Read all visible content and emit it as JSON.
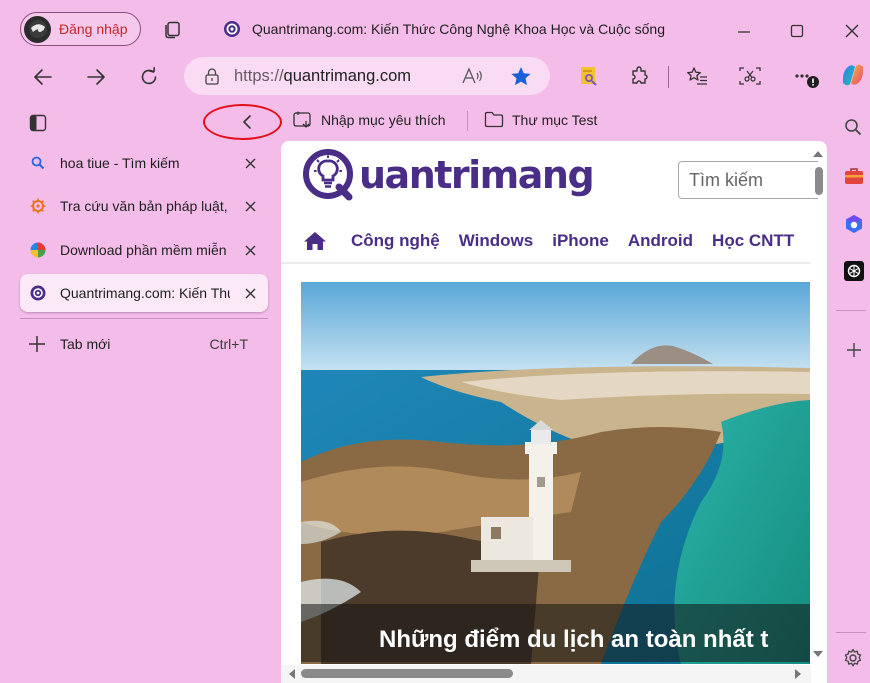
{
  "profile": {
    "label": "Đăng nhập"
  },
  "window": {
    "title": "Quantrimang.com: Kiến Thức Công Nghệ Khoa Học và Cuộc sống"
  },
  "address_bar": {
    "url_protocol": "https://",
    "url_host": "quantrimang.com"
  },
  "favorites": [
    {
      "label": "Nhập mục yêu thích"
    },
    {
      "label": "Thư mục Test"
    }
  ],
  "tabs": [
    {
      "label": "hoa tiue - Tìm kiếm",
      "icon": "search-icon",
      "active": false
    },
    {
      "label": "Tra cứu văn bản pháp luật, ",
      "icon": "wheel-icon",
      "active": false
    },
    {
      "label": "Download phần mềm miễn",
      "icon": "pinwheel-icon",
      "active": false
    },
    {
      "label": "Quantrimang.com: Kiến Thứ",
      "icon": "at-icon",
      "active": true
    }
  ],
  "new_tab": {
    "label": "Tab mới",
    "shortcut": "Ctrl+T"
  },
  "site": {
    "logo_text": "uantrimang",
    "search_placeholder": "Tìm kiếm",
    "nav": [
      "Công nghệ",
      "Windows",
      "iPhone",
      "Android",
      "Học CNTT"
    ],
    "hero_caption": "Những điểm du lịch an toàn nhất t"
  },
  "colors": {
    "accent": "#4a2d86",
    "browser_bg": "#f4bce9",
    "annotation": "#e3101a",
    "profile_text": "#c4272b"
  }
}
